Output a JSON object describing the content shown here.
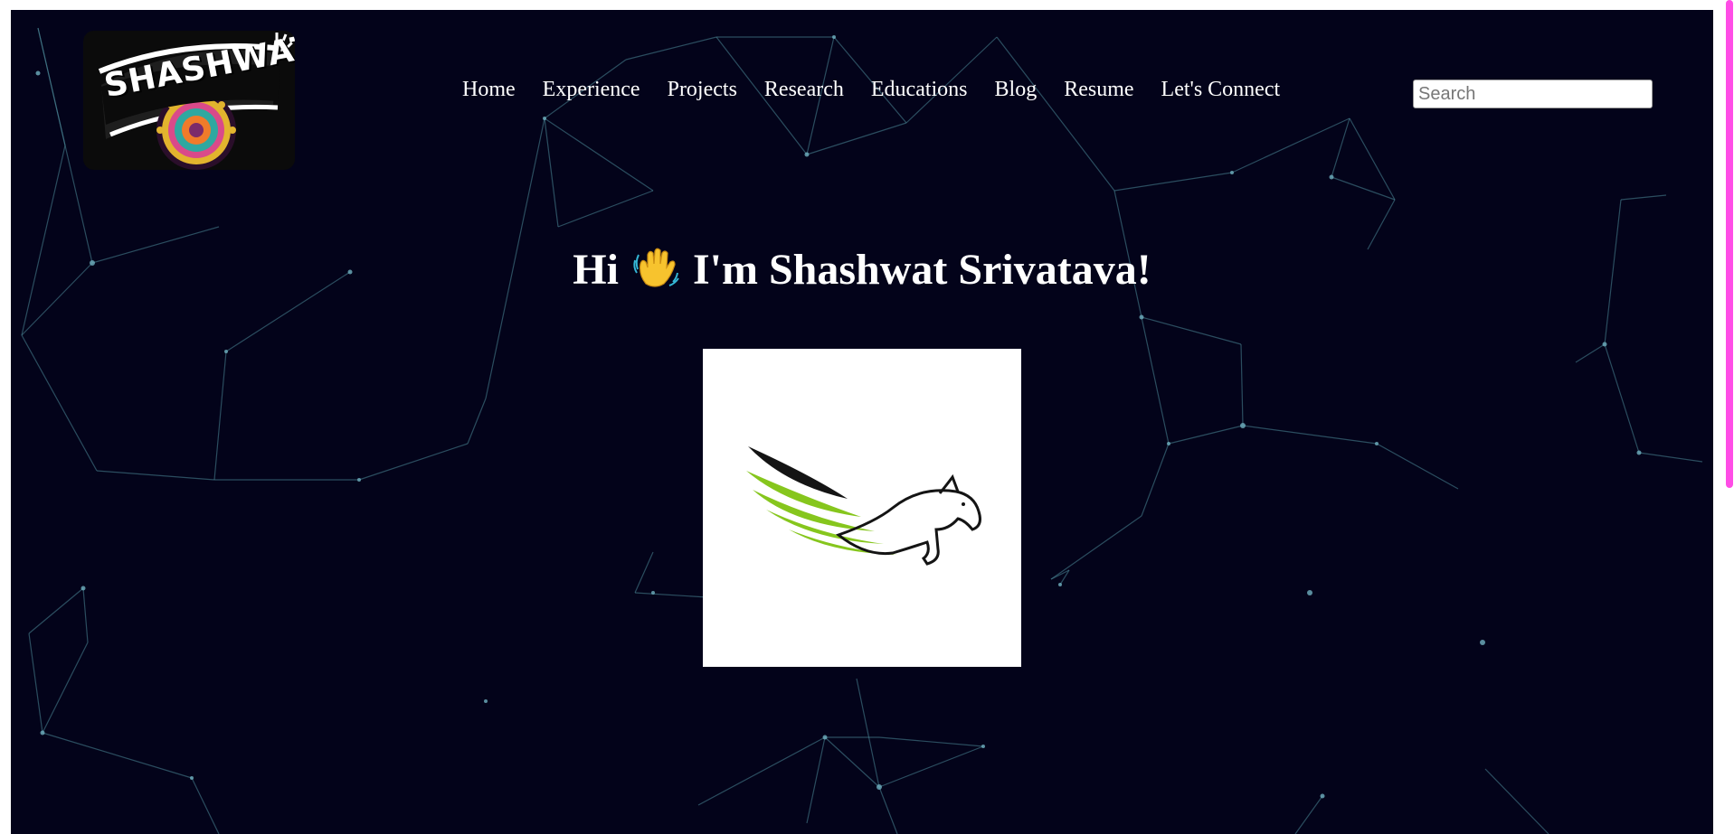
{
  "logo": {
    "text": "SHASHWAT",
    "icon": "shashwat-mandala-logo"
  },
  "nav": {
    "items": [
      {
        "label": "Home"
      },
      {
        "label": "Experience"
      },
      {
        "label": "Projects"
      },
      {
        "label": "Research"
      },
      {
        "label": "Educations"
      },
      {
        "label": "Blog"
      },
      {
        "label": "Resume"
      },
      {
        "label": "Let's Connect"
      }
    ]
  },
  "search": {
    "placeholder": "Search",
    "value": ""
  },
  "hero": {
    "greeting_prefix": "Hi",
    "wave_icon": "waving-hand-icon",
    "greeting_suffix": "I'm Shashwat Srivatava!",
    "image_icon": "winged-horse-logo"
  },
  "colors": {
    "background": "#03031a",
    "network_lines": "#4d8b99",
    "scrollbar_thumb": "#ff4de6",
    "text": "#ffffff"
  }
}
